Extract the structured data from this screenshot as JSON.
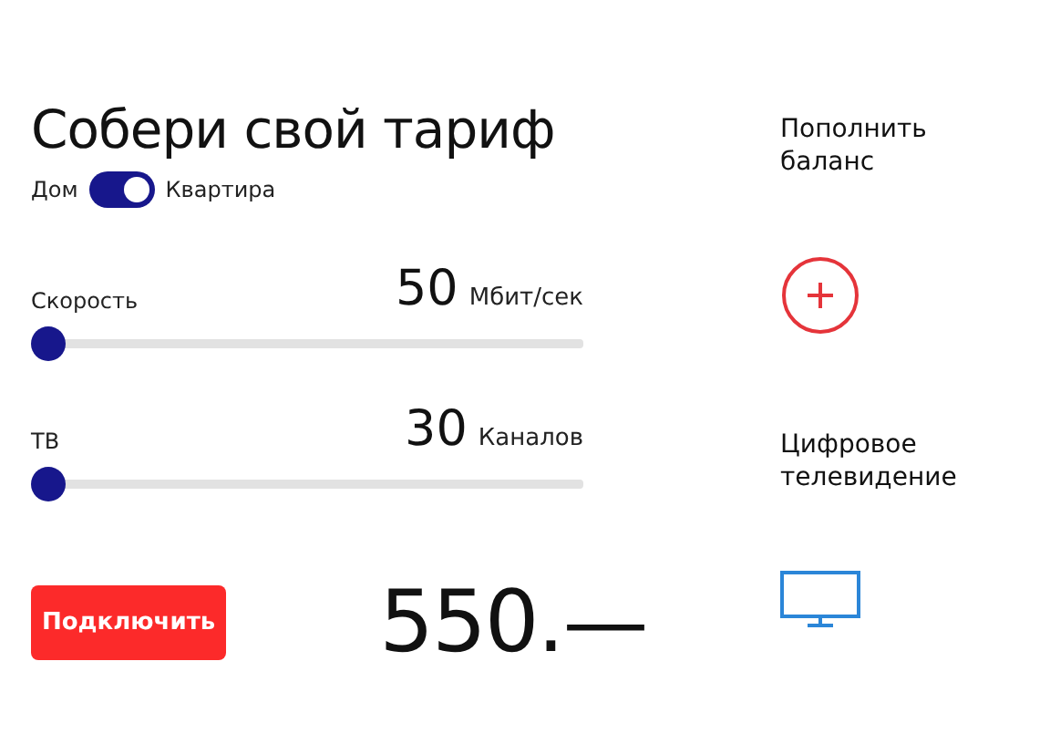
{
  "title": "Собери свой тариф",
  "toggle": {
    "left_label": "Дом",
    "right_label": "Квартира",
    "on": true
  },
  "sliders": [
    {
      "label": "Скорость",
      "value": "50",
      "unit": "Мбит/сек",
      "level": 0
    },
    {
      "label": "ТВ",
      "value": "30",
      "unit": "Каналов",
      "level": 0
    }
  ],
  "connect_button": "Подключить",
  "price": "550.—",
  "side": [
    {
      "kind": "plus",
      "title": "Пополнить баланс"
    },
    {
      "kind": "tv",
      "title": "Цифровое телевидение"
    }
  ]
}
